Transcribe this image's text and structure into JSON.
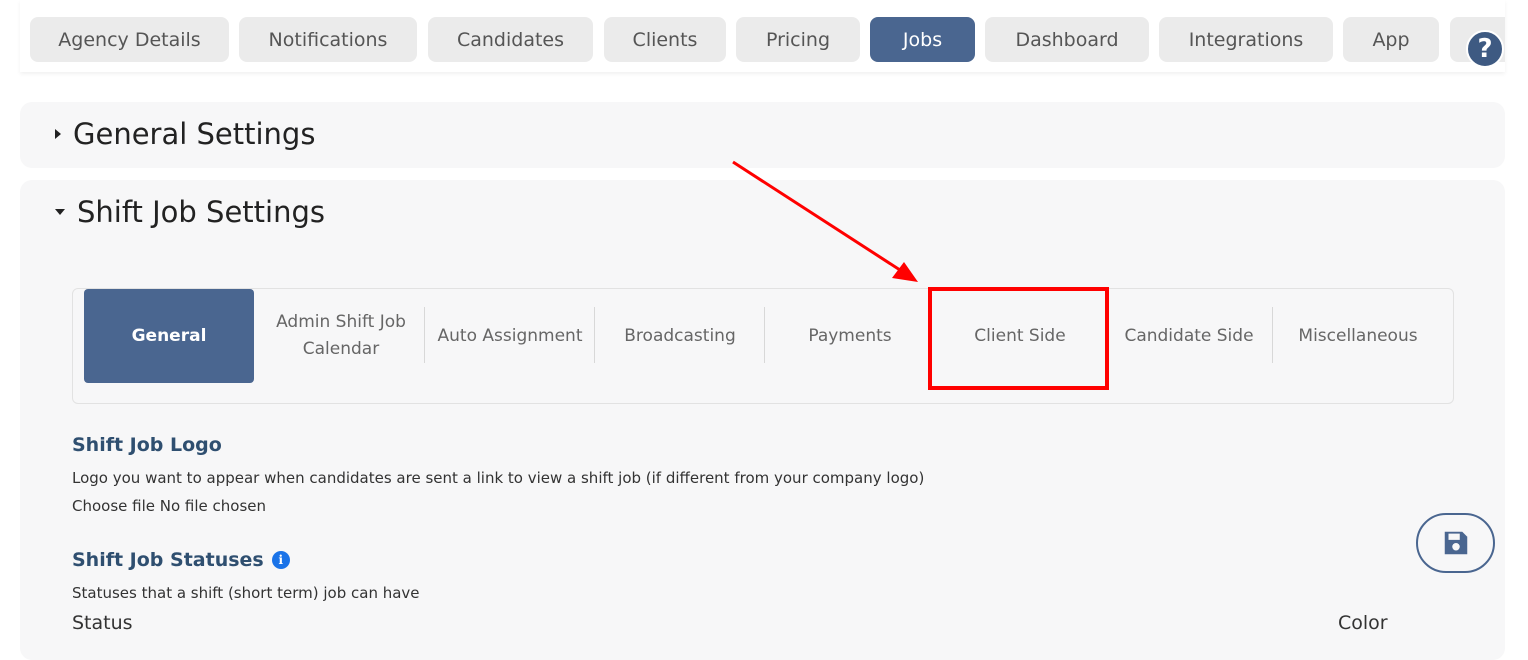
{
  "top_tabs": [
    {
      "label": "Agency Details"
    },
    {
      "label": "Notifications"
    },
    {
      "label": "Candidates"
    },
    {
      "label": "Clients"
    },
    {
      "label": "Pricing"
    },
    {
      "label": "Jobs",
      "active": true
    },
    {
      "label": "Dashboard"
    },
    {
      "label": "Integrations"
    },
    {
      "label": "App"
    }
  ],
  "help_icon": "question-mark-icon",
  "general_settings": {
    "title": "General Settings"
  },
  "shift_job_settings": {
    "title": "Shift Job Settings",
    "subtabs": [
      {
        "label": "General",
        "active": true
      },
      {
        "label": "Admin Shift Job Calendar"
      },
      {
        "label": "Auto Assignment"
      },
      {
        "label": "Broadcasting"
      },
      {
        "label": "Payments"
      },
      {
        "label": "Client Side",
        "highlighted": true
      },
      {
        "label": "Candidate Side"
      },
      {
        "label": "Miscellaneous"
      }
    ],
    "logo": {
      "title": "Shift Job Logo",
      "description": "Logo you want to appear when candidates are sent a link to view a shift job (if different from your company logo)",
      "file_input": "Choose file No file chosen"
    },
    "statuses": {
      "title": "Shift Job Statuses",
      "description": "Statuses that a shift (short term) job can have",
      "col_status": "Status",
      "col_color": "Color"
    }
  },
  "colors": {
    "active_tab": "#4a6690",
    "annotation": "#ff0000",
    "section_title": "#2f4f70"
  }
}
